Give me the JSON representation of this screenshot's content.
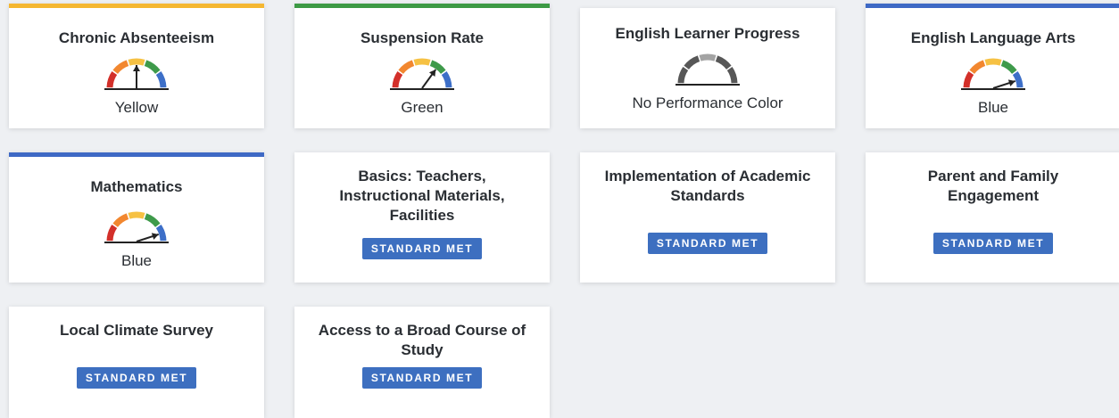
{
  "colors": {
    "yellow_bar": "#f5b731",
    "green_bar": "#3d9a45",
    "blue_bar": "#3e69c5",
    "gauge_red": "#d3302a",
    "gauge_orange": "#f2872f",
    "gauge_yellow": "#f6c143",
    "gauge_green": "#3e9a4a",
    "gauge_blue": "#3d6fc8",
    "gauge_gray_dark": "#575757",
    "gauge_gray_light": "#a3a3a3",
    "badge": "#3d6fc0"
  },
  "cards": [
    {
      "title": "Chronic Absenteeism",
      "performance_color": "Yellow",
      "gauge_level": "yellow",
      "top_bar": "yellow"
    },
    {
      "title": "Suspension Rate",
      "performance_color": "Green",
      "gauge_level": "green",
      "top_bar": "green"
    },
    {
      "title": "English Learner Progress",
      "performance_color": "No Performance Color",
      "gauge_level": "none",
      "top_bar": "none"
    },
    {
      "title": "English Language Arts",
      "performance_color": "Blue",
      "gauge_level": "blue",
      "top_bar": "blue"
    },
    {
      "title": "Mathematics",
      "performance_color": "Blue",
      "gauge_level": "blue",
      "top_bar": "blue"
    },
    {
      "title_lines": [
        "Basics: Teachers,",
        "Instructional Materials,",
        "Facilities"
      ],
      "status": "STANDARD MET"
    },
    {
      "title_lines": [
        "Implementation of Academic",
        "Standards"
      ],
      "status": "STANDARD MET"
    },
    {
      "title_lines": [
        "Parent and Family",
        "Engagement"
      ],
      "status": "STANDARD MET"
    },
    {
      "title": "Local Climate Survey",
      "status": "STANDARD MET"
    },
    {
      "title_lines": [
        "Access to a Broad Course of",
        "Study"
      ],
      "status": "STANDARD MET"
    }
  ]
}
